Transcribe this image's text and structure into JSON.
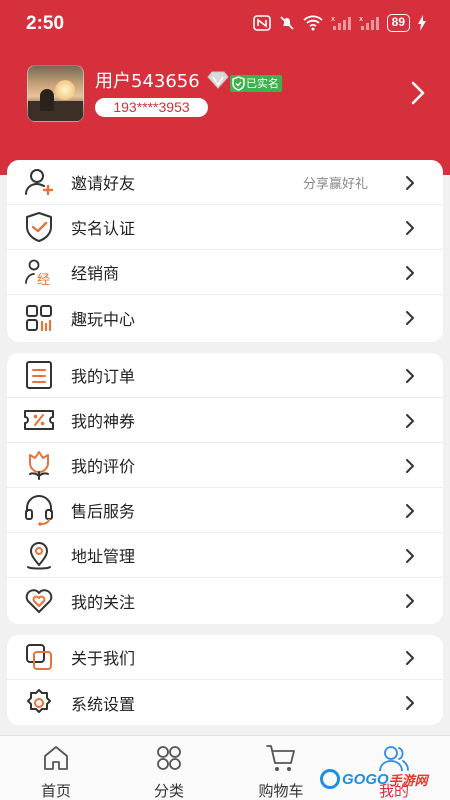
{
  "status_bar": {
    "time": "2:50",
    "battery": "89",
    "icons": [
      "nfc-icon",
      "mute-icon",
      "wifi-icon",
      "signal-icon",
      "signal-icon",
      "battery-icon",
      "charging-icon"
    ]
  },
  "profile": {
    "username": "用户543656",
    "verified_label": "已实名",
    "phone": "193****3953"
  },
  "groups": [
    {
      "items": [
        {
          "label": "邀请好友",
          "sub": "分享赢好礼",
          "icon": "invite-friend-icon"
        },
        {
          "label": "实名认证",
          "icon": "shield-check-icon"
        },
        {
          "label": "经销商",
          "icon": "dealer-icon"
        },
        {
          "label": "趣玩中心",
          "icon": "grid-apps-icon"
        }
      ]
    },
    {
      "items": [
        {
          "label": "我的订单",
          "icon": "order-list-icon"
        },
        {
          "label": "我的神券",
          "icon": "coupon-icon"
        },
        {
          "label": "我的评价",
          "icon": "review-flower-icon"
        },
        {
          "label": "售后服务",
          "icon": "headset-icon"
        },
        {
          "label": "地址管理",
          "icon": "location-pin-icon"
        },
        {
          "label": "我的关注",
          "icon": "heart-icon"
        }
      ]
    },
    {
      "items": [
        {
          "label": "关于我们",
          "icon": "about-icon"
        },
        {
          "label": "系统设置",
          "icon": "settings-gear-icon"
        }
      ]
    }
  ],
  "tabbar": {
    "home": "首页",
    "category": "分类",
    "cart": "购物车",
    "mine": "我的"
  },
  "watermark": {
    "brand": "GOGO",
    "site": "手游网"
  },
  "colors": {
    "brand": "#d6303d",
    "icon_accent": "#e8733a",
    "verified": "#3fb24e"
  }
}
